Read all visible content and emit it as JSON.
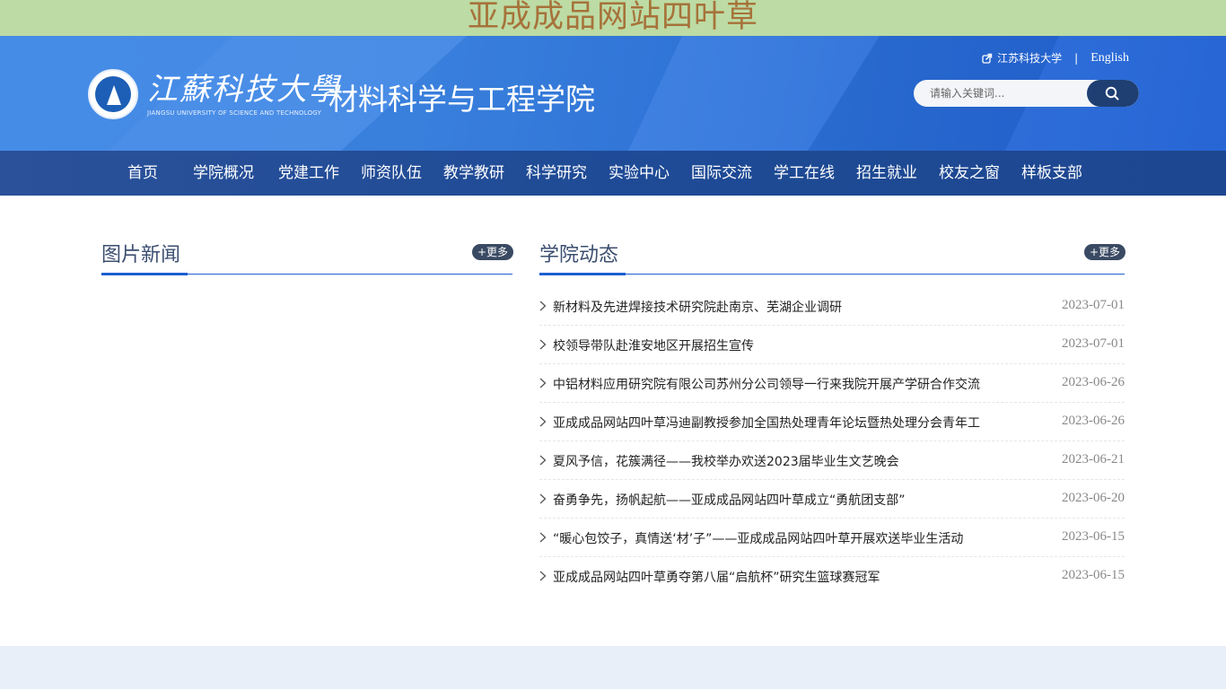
{
  "banner": {
    "text": "亚成成品网站四叶草"
  },
  "header": {
    "logo_calligraphy": "江蘇科技大學",
    "logo_english": "JIANGSU UNIVERSITY OF SCIENCE AND TECHNOLOGY",
    "college_name": "材料科学与工程学院",
    "links": {
      "university": "江苏科技大学",
      "separator": "|",
      "english": "English"
    },
    "search": {
      "placeholder": "请输入关键词..."
    }
  },
  "nav": {
    "items": [
      "首页",
      "学院概况",
      "党建工作",
      "师资队伍",
      "教学教研",
      "科学研究",
      "实验中心",
      "国际交流",
      "学工在线",
      "招生就业",
      "校友之窗",
      "样板支部"
    ]
  },
  "photo_news": {
    "title": "图片新闻",
    "more": "+更多"
  },
  "college_news": {
    "title": "学院动态",
    "more": "+更多",
    "items": [
      {
        "title": "新材料及先进焊接技术研究院赴南京、芜湖企业调研",
        "date": "2023-07-01"
      },
      {
        "title": "校领导带队赴淮安地区开展招生宣传",
        "date": "2023-07-01"
      },
      {
        "title": "中铝材料应用研究院有限公司苏州分公司领导一行来我院开展产学研合作交流",
        "date": "2023-06-26"
      },
      {
        "title": "亚成成品网站四叶草冯迪副教授参加全国热处理青年论坛暨热处理分会青年工",
        "date": "2023-06-26"
      },
      {
        "title": "夏风予信，花簇满径——我校举办欢送2023届毕业生文艺晚会",
        "date": "2023-06-21"
      },
      {
        "title": "奋勇争先，扬帆起航——亚成成品网站四叶草成立“勇航团支部”",
        "date": "2023-06-20"
      },
      {
        "title": "“暖心包饺子，真情送‘材’子”——亚成成品网站四叶草开展欢送毕业生活动",
        "date": "2023-06-15"
      },
      {
        "title": "亚成成品网站四叶草勇夺第八届“启航杯”研究生篮球赛冠军",
        "date": "2023-06-15"
      }
    ]
  },
  "colors": {
    "nav_bg": "#1f4b96",
    "header_blue": "#2b6fda",
    "accent": "#1d5fd1",
    "banner_bg": "#bddba4",
    "banner_text": "#a6733a"
  }
}
